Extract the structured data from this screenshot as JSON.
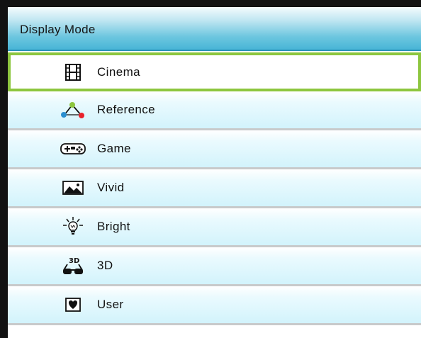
{
  "menu": {
    "title": "Display Mode",
    "selected_index": 0,
    "items": [
      {
        "label": "Cinema",
        "icon": "film-strip-icon"
      },
      {
        "label": "Reference",
        "icon": "color-triangle-icon"
      },
      {
        "label": "Game",
        "icon": "gamepad-icon"
      },
      {
        "label": "Vivid",
        "icon": "landscape-picture-icon"
      },
      {
        "label": "Bright",
        "icon": "light-bulb-icon"
      },
      {
        "label": "3D",
        "icon": "3d-glasses-icon"
      },
      {
        "label": "User",
        "icon": "heart-icon"
      }
    ]
  },
  "colors": {
    "selection_border": "#8dc63f",
    "header_blue": "#48b5d6",
    "row_tint": "#d2f3fc"
  }
}
